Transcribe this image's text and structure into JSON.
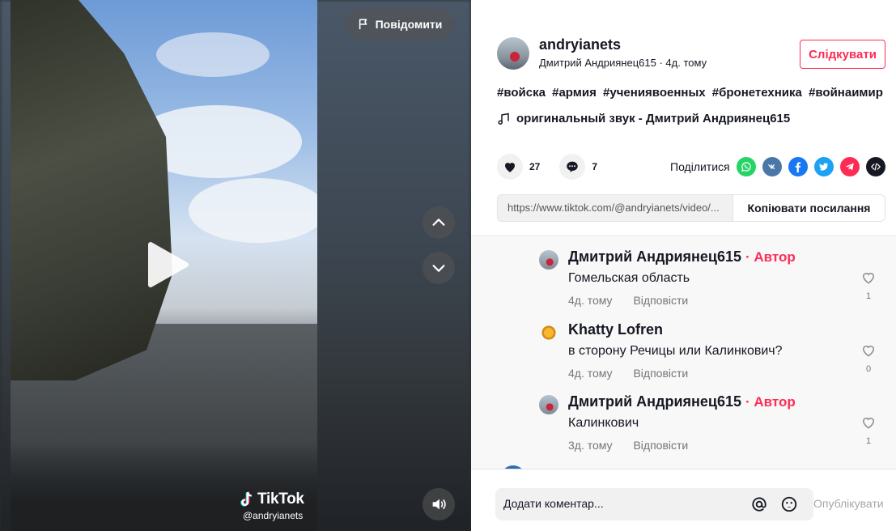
{
  "video": {
    "report_label": "Повідомити",
    "watermark_logo": "TikTok",
    "watermark_user": "@andryianets"
  },
  "author": {
    "username": "andryianets",
    "display_name": "Дмитрий Андриянец615",
    "separator": " · ",
    "posted": "4д. тому",
    "follow_label": "Слідкувати"
  },
  "description": {
    "hashtags": [
      "#войска",
      "#армия",
      "#учениявоенных",
      "#бронетехника",
      "#войнаимир"
    ],
    "music": "оригинальный звук - Дмитрий Андриянец615"
  },
  "actions": {
    "likes": "27",
    "comments": "7",
    "share_label": "Поділитися"
  },
  "link": {
    "url": "https://www.tiktok.com/@andryianets/video/...",
    "copy_label": "Копіювати посилання"
  },
  "comments": [
    {
      "name": "Дмитрий Андриянец615",
      "author_tag": "· Автор",
      "text": "Гомельская область",
      "time": "4д. тому",
      "reply": "Відповісти",
      "likes": "1"
    },
    {
      "name": "Khatty Lofren",
      "author_tag": "",
      "text": "в сторону Речицы или Калинкович?",
      "time": "4д. тому",
      "reply": "Відповісти",
      "likes": "0"
    },
    {
      "name": "Дмитрий Андриянец615",
      "author_tag": "· Автор",
      "text": "Калинкович",
      "time": "3д. тому",
      "reply": "Відповісти",
      "likes": "1"
    }
  ],
  "composer": {
    "placeholder": "Додати коментар...",
    "post_label": "Опублікувати"
  },
  "colors": {
    "accent": "#fe2c55",
    "whatsapp": "#25d366",
    "vk": "#4a76a8",
    "facebook": "#1877f2",
    "twitter": "#1da1f2",
    "telegram": "#fe2c55"
  }
}
